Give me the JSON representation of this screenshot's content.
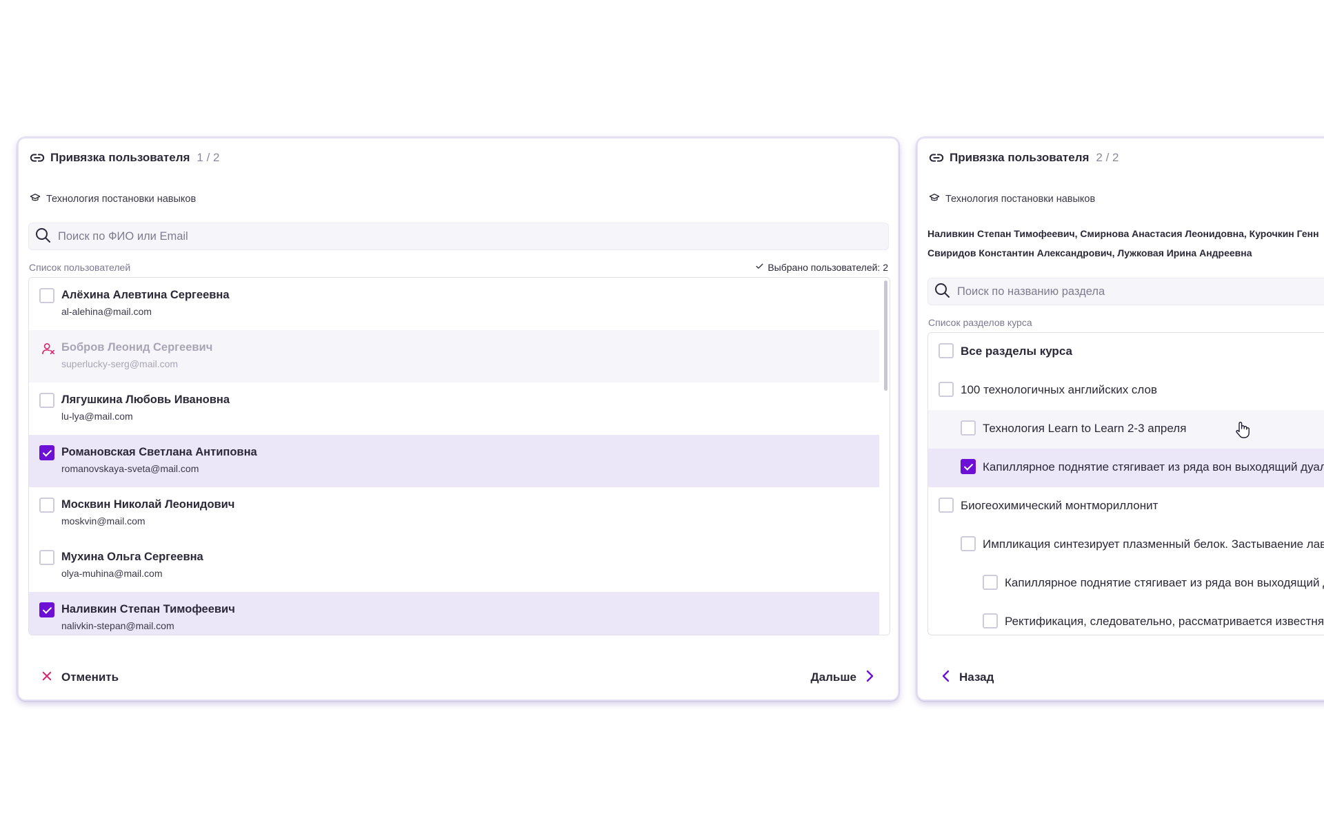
{
  "dialog1": {
    "title": "Привязка пользователя",
    "step": "1 / 2",
    "course": "Технология постановки навыков",
    "search_placeholder": "Поиск по ФИО или Email",
    "list_caption": "Список пользователей",
    "selected_label": "Выбрано пользователей: 2",
    "users": [
      {
        "name": "Алёхина Алевтина Сергеевна",
        "email": "al-alehina@mail.com",
        "state": "unchecked"
      },
      {
        "name": "Бобров Леонид Сергеевич",
        "email": "superlucky-serg@mail.com",
        "state": "disabled"
      },
      {
        "name": "Лягушкина Любовь Ивановна",
        "email": "lu-lya@mail.com",
        "state": "unchecked"
      },
      {
        "name": "Романовская Светлана Антиповна",
        "email": "romanovskaya-sveta@mail.com",
        "state": "checked"
      },
      {
        "name": "Москвин Николай Леонидович",
        "email": "moskvin@mail.com",
        "state": "unchecked"
      },
      {
        "name": "Мухина Ольга Сергеевна",
        "email": "olya-muhina@mail.com",
        "state": "unchecked"
      },
      {
        "name": "Наливкин Степан Тимофеевич",
        "email": "nalivkin-stepan@mail.com",
        "state": "checked"
      }
    ],
    "cancel_label": "Отменить",
    "next_label": "Дальше"
  },
  "dialog2": {
    "title": "Привязка пользователя",
    "step": "2 / 2",
    "course": "Технология постановки навыков",
    "selected_names_line1": "Наливкин Степан Тимофеевич, Смирнова Анастасия Леонидовна, Курочкин Генн",
    "selected_names_line2": "Свиридов Константин Александрович, Лужковая Ирина Андреевна",
    "search_placeholder": "Поиск по названию раздела",
    "list_caption": "Список разделов курса",
    "sections": [
      {
        "label": "Все разделы курса",
        "level": 0,
        "checked": false,
        "bold": true
      },
      {
        "label": "100 технологичных английских слов",
        "level": 0,
        "checked": false,
        "bold": false
      },
      {
        "label": "Технология Learn to Learn 2-3 апреля",
        "level": 1,
        "checked": false,
        "bold": false
      },
      {
        "label": "Капиллярное поднятие стягивает из ряда вон выходящий дуал",
        "level": 1,
        "checked": true,
        "bold": false
      },
      {
        "label": "Биогеохимический монтмориллонит",
        "level": 0,
        "checked": false,
        "bold": false
      },
      {
        "label": "Импликация синтезирует плазменный белок. Застываение лав",
        "level": 1,
        "checked": false,
        "bold": false
      },
      {
        "label": "Капиллярное поднятие стягивает из ряда вон выходящий д",
        "level": 2,
        "checked": false,
        "bold": false
      },
      {
        "label": "Ректификация, следовательно, рассматривается известняк",
        "level": 2,
        "checked": false,
        "bold": false
      }
    ],
    "back_label": "Назад"
  },
  "colors": {
    "accent": "#6c10d6",
    "cancel": "#d6246e",
    "selected_row": "#ebe6f8",
    "muted_row": "#f6f5f9"
  },
  "icons": [
    "link-icon",
    "graduation-cap-icon",
    "search-icon",
    "check-icon",
    "user-blocked-icon",
    "close-icon",
    "chevron-right-icon",
    "chevron-left-icon",
    "hand-cursor-icon"
  ]
}
